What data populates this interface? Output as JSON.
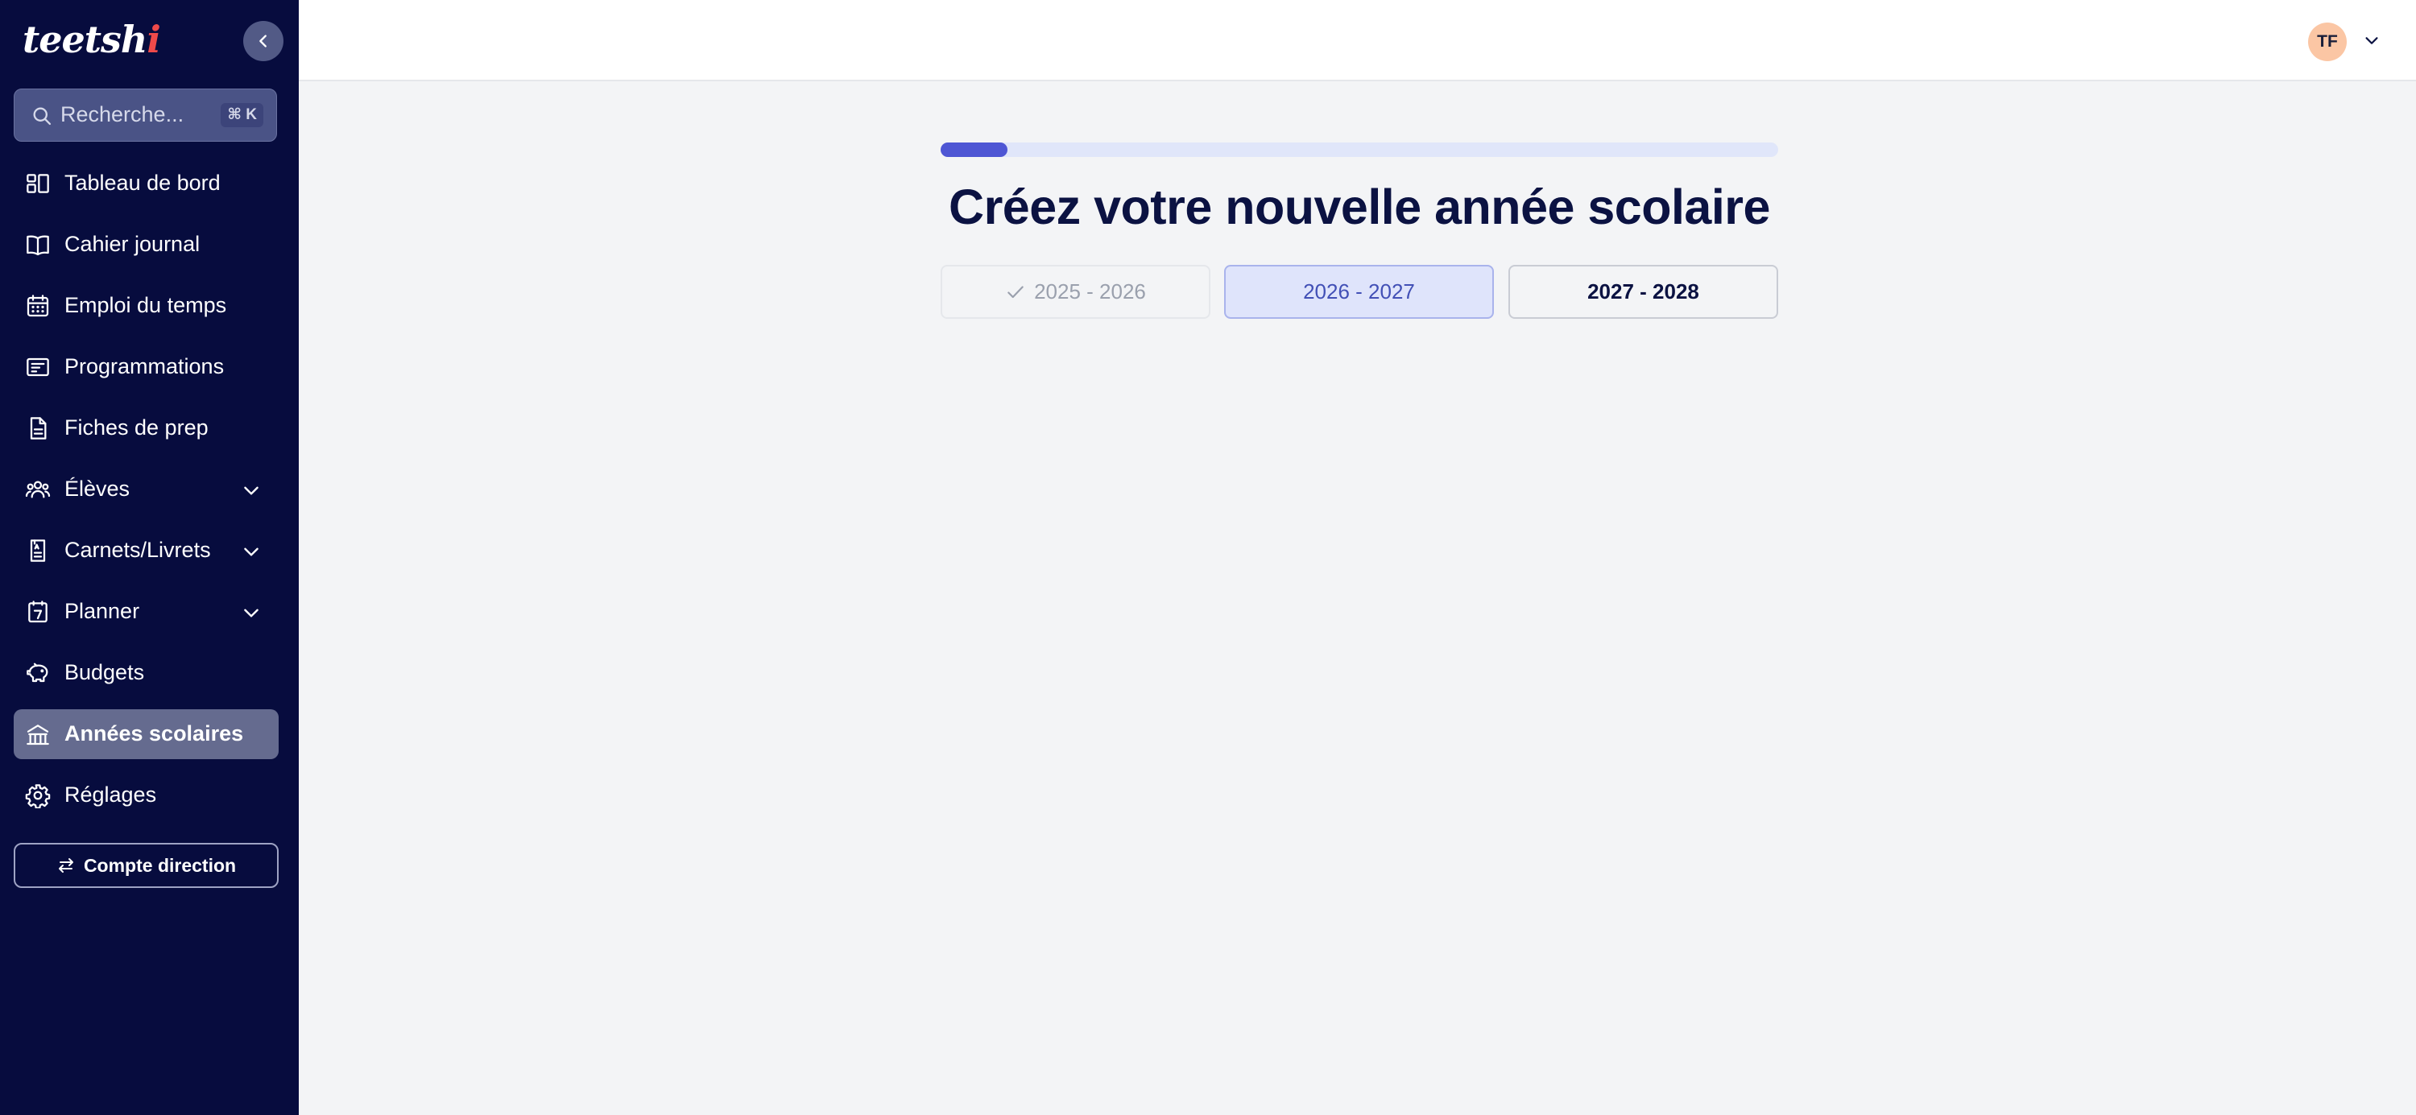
{
  "app": {
    "logo_text": "teetsh",
    "logo_accent": "i"
  },
  "sidebar": {
    "search_placeholder": "Recherche...",
    "search_shortcut": "⌘ K",
    "items": [
      {
        "label": "Tableau de bord",
        "icon": "dashboard-icon",
        "expandable": false,
        "active": false
      },
      {
        "label": "Cahier journal",
        "icon": "book-icon",
        "expandable": false,
        "active": false
      },
      {
        "label": "Emploi du temps",
        "icon": "calendar-icon",
        "expandable": false,
        "active": false
      },
      {
        "label": "Programmations",
        "icon": "list-card-icon",
        "expandable": false,
        "active": false
      },
      {
        "label": "Fiches de prep",
        "icon": "document-icon",
        "expandable": false,
        "active": false
      },
      {
        "label": "Élèves",
        "icon": "users-icon",
        "expandable": true,
        "active": false
      },
      {
        "label": "Carnets/Livrets",
        "icon": "booklet-icon",
        "expandable": true,
        "active": false
      },
      {
        "label": "Planner",
        "icon": "planner-icon",
        "expandable": true,
        "active": false
      },
      {
        "label": "Budgets",
        "icon": "piggy-bank-icon",
        "expandable": false,
        "active": false
      },
      {
        "label": "Années scolaires",
        "icon": "school-building-icon",
        "expandable": false,
        "active": true
      },
      {
        "label": "Réglages",
        "icon": "gear-icon",
        "expandable": false,
        "active": false
      }
    ],
    "account_button": "Compte direction"
  },
  "header": {
    "avatar_initials": "TF"
  },
  "main": {
    "progress": 0.08,
    "title": "Créez votre nouvelle année scolaire",
    "years": [
      {
        "label": "2025 - 2026",
        "state": "done"
      },
      {
        "label": "2026 - 2027",
        "state": "selected"
      },
      {
        "label": "2027 - 2028",
        "state": "plain"
      }
    ]
  },
  "colors": {
    "sidebar_bg": "#070c3e",
    "accent": "#4e56d4",
    "title": "#0b1242",
    "selected_bg": "#dfe4fb",
    "avatar_bg": "#fbc6a4"
  }
}
